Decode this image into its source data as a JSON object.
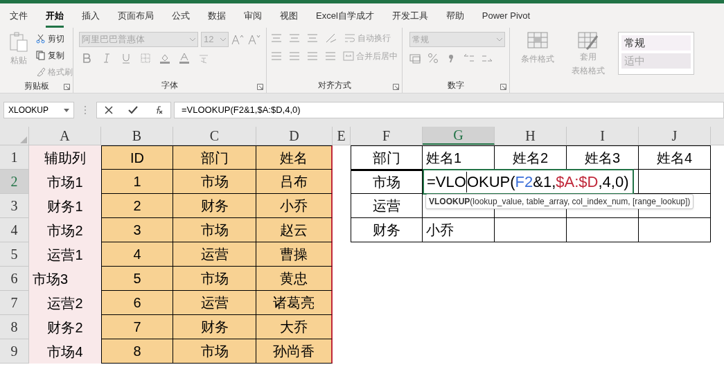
{
  "menu_tabs": [
    {
      "label": "文件",
      "selected": false
    },
    {
      "label": "开始",
      "selected": true
    },
    {
      "label": "插入",
      "selected": false
    },
    {
      "label": "页面布局",
      "selected": false
    },
    {
      "label": "公式",
      "selected": false
    },
    {
      "label": "数据",
      "selected": false
    },
    {
      "label": "审阅",
      "selected": false
    },
    {
      "label": "视图",
      "selected": false
    },
    {
      "label": "Excel自学成才",
      "selected": false
    },
    {
      "label": "开发工具",
      "selected": false
    },
    {
      "label": "帮助",
      "selected": false
    },
    {
      "label": "Power Pivot",
      "selected": false
    }
  ],
  "ribbon": {
    "clipboard": {
      "paste": {
        "label": "粘贴",
        "disabled": true
      },
      "items": [
        {
          "label": "剪切",
          "disabled": false
        },
        {
          "label": "复制",
          "disabled": false
        },
        {
          "label": "格式刷",
          "disabled": true
        }
      ],
      "label": "剪贴板"
    },
    "font": {
      "font_name": "阿里巴巴普惠体",
      "font_size": "12",
      "label": "字体"
    },
    "alignment": {
      "wrap": "自动换行",
      "merge": "合并后居中",
      "label": "对齐方式"
    },
    "number": {
      "format": "常规",
      "label": "数字"
    },
    "styles": {
      "conditional": "条件格式",
      "table_format": [
        "套用",
        "表格格式"
      ],
      "gallery": [
        "常规",
        "适中"
      ]
    }
  },
  "name_box": "XLOOKUP",
  "formula": "=VLOOKUP(F2&1,$A:$D,4,0)",
  "columns": [
    {
      "label": "A",
      "selected": false
    },
    {
      "label": "B",
      "selected": false
    },
    {
      "label": "C",
      "selected": false
    },
    {
      "label": "D",
      "selected": false
    },
    {
      "label": "E",
      "selected": false
    },
    {
      "label": "F",
      "selected": false
    },
    {
      "label": "G",
      "selected": true
    },
    {
      "label": "H",
      "selected": false
    },
    {
      "label": "I",
      "selected": false
    },
    {
      "label": "J",
      "selected": false
    }
  ],
  "rows": [
    {
      "header": "1",
      "selected": false,
      "cells": [
        "辅助列",
        "ID",
        "部门",
        "姓名",
        null,
        "部门",
        "姓名1",
        "姓名2",
        "姓名3",
        "姓名4"
      ]
    },
    {
      "header": "2",
      "selected": true,
      "cells": [
        "市场1",
        "1",
        "市场",
        "吕布",
        null,
        "市场",
        null,
        null,
        null,
        null
      ]
    },
    {
      "header": "3",
      "selected": false,
      "cells": [
        "财务1",
        "2",
        "财务",
        "小乔",
        null,
        "运营",
        null,
        null,
        null,
        null
      ]
    },
    {
      "header": "4",
      "selected": false,
      "cells": [
        "市场2",
        "3",
        "市场",
        "赵云",
        null,
        "财务",
        "小乔",
        null,
        null,
        null
      ]
    },
    {
      "header": "5",
      "selected": false,
      "cells": [
        "运营1",
        "4",
        "运营",
        "曹操",
        null,
        null,
        null,
        null,
        null,
        null
      ]
    },
    {
      "header": "6",
      "selected": false,
      "cells": [
        {
          "text": "市场3",
          "left_aligned": true
        },
        "5",
        "市场",
        "黄忠",
        null,
        null,
        null,
        null,
        null,
        null
      ]
    },
    {
      "header": "7",
      "selected": false,
      "cells": [
        "运营2",
        "6",
        "运营",
        "诸葛亮",
        null,
        null,
        null,
        null,
        null,
        null
      ]
    },
    {
      "header": "8",
      "selected": false,
      "cells": [
        "财务2",
        "7",
        "财务",
        "大乔",
        null,
        null,
        null,
        null,
        null,
        null
      ]
    },
    {
      "header": "9",
      "selected": false,
      "cells": [
        "市场4",
        "8",
        "市场",
        "孙尚香",
        null,
        null,
        null,
        null,
        null,
        null
      ]
    }
  ],
  "editor": {
    "segments": [
      {
        "text": "=VLO",
        "color": "#000000"
      },
      {
        "text": "OKUP(",
        "color": "#000000"
      },
      {
        "text": "F2",
        "color": "#3b6fd8"
      },
      {
        "text": "&1,",
        "color": "#000000"
      },
      {
        "text": "$A:$D",
        "color": "#c0283a"
      },
      {
        "text": ",4,0)",
        "color": "#000000"
      }
    ]
  },
  "tooltip": "**VLOOKUP**(lookup_value, table_array, col_index_num, [range_lookup])"
}
